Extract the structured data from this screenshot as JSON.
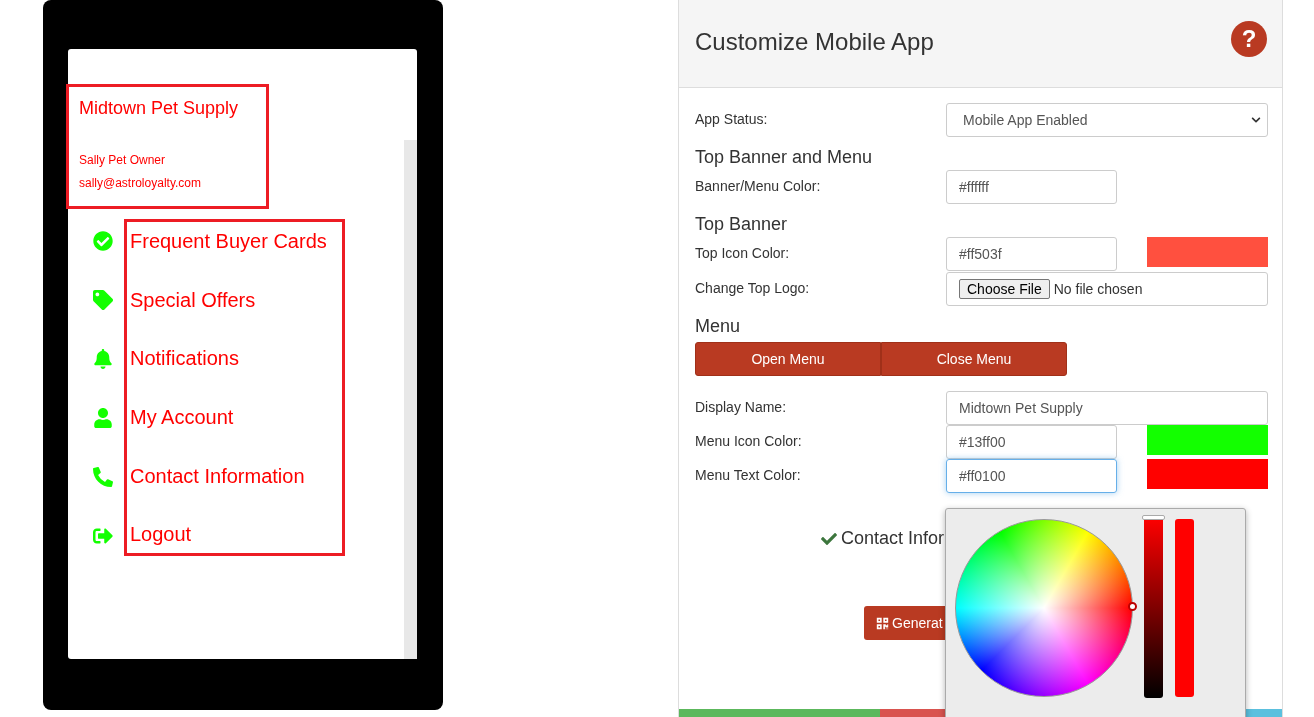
{
  "preview": {
    "store_name": "Midtown Pet Supply",
    "user_name": "Sally Pet Owner",
    "user_email": "sally@astroloyalty.com",
    "menu": [
      "Frequent Buyer Cards",
      "Special Offers",
      "Notifications",
      "My Account",
      "Contact Information",
      "Logout"
    ]
  },
  "panel": {
    "title": "Customize Mobile App",
    "help_button": "?",
    "form": [
      {
        "kind": "select",
        "label": "App Status:",
        "value": "Mobile App Enabled"
      },
      {
        "kind": "heading",
        "text": "Top Banner and Menu"
      },
      {
        "kind": "color",
        "label": "Banner/Menu Color:",
        "value": "#ffffff",
        "focused": false
      },
      {
        "kind": "heading",
        "text": "Top Banner"
      },
      {
        "kind": "color",
        "label": "Top Icon Color:",
        "value": "#ff503f",
        "color": "#ff503f",
        "focused": false
      },
      {
        "kind": "file",
        "label": "Change Top Logo:",
        "button": "Choose File",
        "status": "No file chosen"
      },
      {
        "kind": "heading",
        "text": "Menu"
      },
      {
        "kind": "buttons",
        "buttons": [
          "Open Menu",
          "Close Menu"
        ]
      },
      {
        "kind": "text",
        "label": "Display Name:",
        "value": "Midtown Pet Supply"
      },
      {
        "kind": "color",
        "label": "Menu Icon Color:",
        "value": "#13ff00",
        "color": "#13ff00",
        "focused": false
      },
      {
        "kind": "color",
        "label": "Menu Text Color:",
        "value": "#ff0100",
        "color": "#ff0100",
        "focused": true
      }
    ],
    "contact_heading": "Contact Infor",
    "generate_button": "Generat",
    "color_picker": {
      "brightness": {
        "level": 1
      }
    }
  }
}
